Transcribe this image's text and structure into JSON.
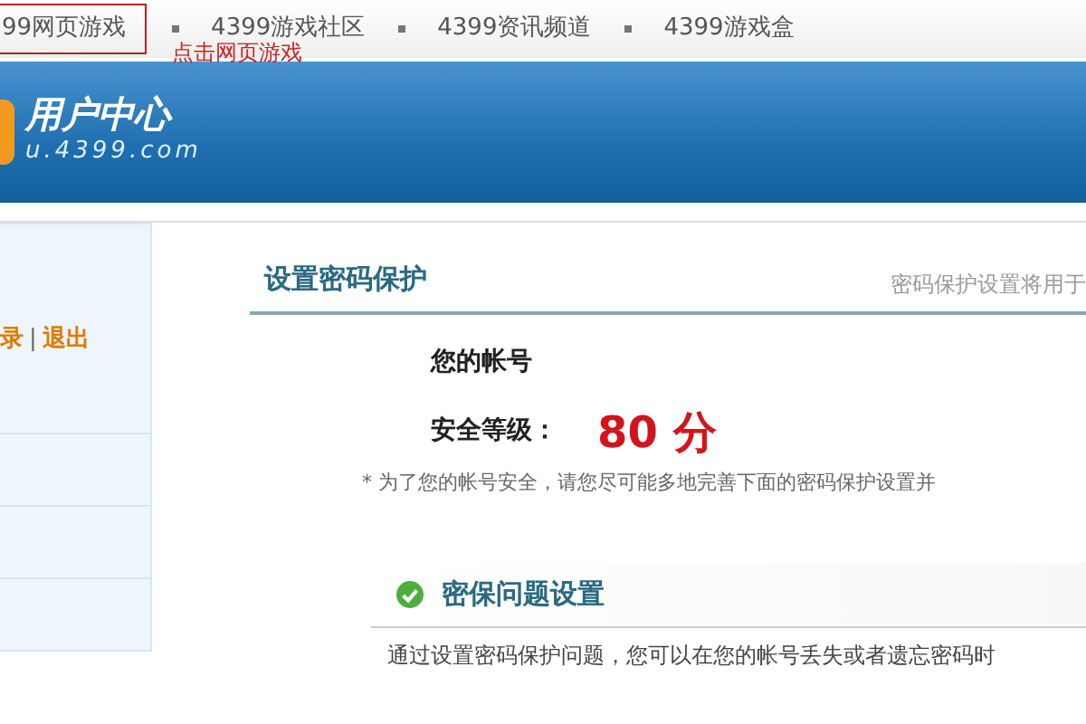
{
  "top_links": [
    {
      "label": "99网页游戏",
      "selected": true
    },
    {
      "label": "4399游戏社区",
      "selected": false
    },
    {
      "label": "4399资讯频道",
      "selected": false
    },
    {
      "label": "4399游戏盒",
      "selected": false
    }
  ],
  "annotation": "点击网页游戏",
  "banner": {
    "title": "用户中心",
    "domain": "u.4399.com"
  },
  "sidebar": {
    "links": [
      "录",
      "退出"
    ],
    "separator": "|"
  },
  "panel": {
    "title": "设置密码保护",
    "hint": "密码保护设置将用于",
    "account_label": "您的帐号",
    "level_label": "安全等级：",
    "score": "80 分",
    "note": "* 为了您的帐号安全，请您尽可能多地完善下面的密码保护设置并",
    "section": {
      "title": "密保问题设置",
      "done": true,
      "description": "通过设置密码保护问题，您可以在您的帐号丢失或者遗忘密码时"
    }
  }
}
